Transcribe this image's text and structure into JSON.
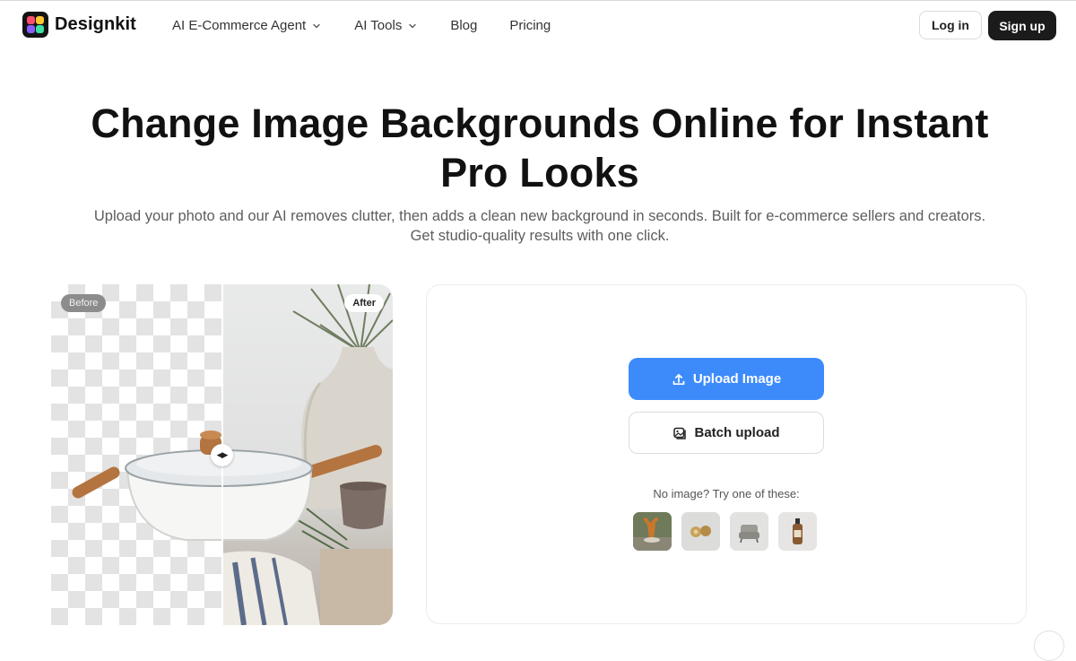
{
  "nav": {
    "brand": "Designkit",
    "menu": [
      {
        "label": "AI E-Commerce Agent",
        "has_dropdown": true
      },
      {
        "label": "AI Tools",
        "has_dropdown": true
      },
      {
        "label": "Blog",
        "has_dropdown": false
      },
      {
        "label": "Pricing",
        "has_dropdown": false
      }
    ],
    "login_label": "Log in",
    "signup_label": "Sign up"
  },
  "hero": {
    "title_line1": "Change Image Backgrounds Online for Instant",
    "title_line2": "Pro Looks",
    "subtitle_line1": "Upload your photo and our AI removes clutter, then adds a clean new background in seconds. Built for e-commerce sellers and creators.",
    "subtitle_line2": "Get studio-quality results with one click."
  },
  "compare": {
    "before_label": "Before",
    "after_label": "After",
    "handle_glyph": "◀▶"
  },
  "upload": {
    "upload_label": "Upload Image",
    "batch_label": "Batch upload",
    "samples_prompt": "No image? Try one of these:",
    "samples": [
      "sample-figurine",
      "sample-earrings",
      "sample-armchair",
      "sample-bottle"
    ]
  },
  "colors": {
    "primary_blue": "#3d8bfb",
    "dark_button": "#1b1b1b",
    "text_dark": "#111111",
    "text_muted": "#5d5d5d"
  }
}
